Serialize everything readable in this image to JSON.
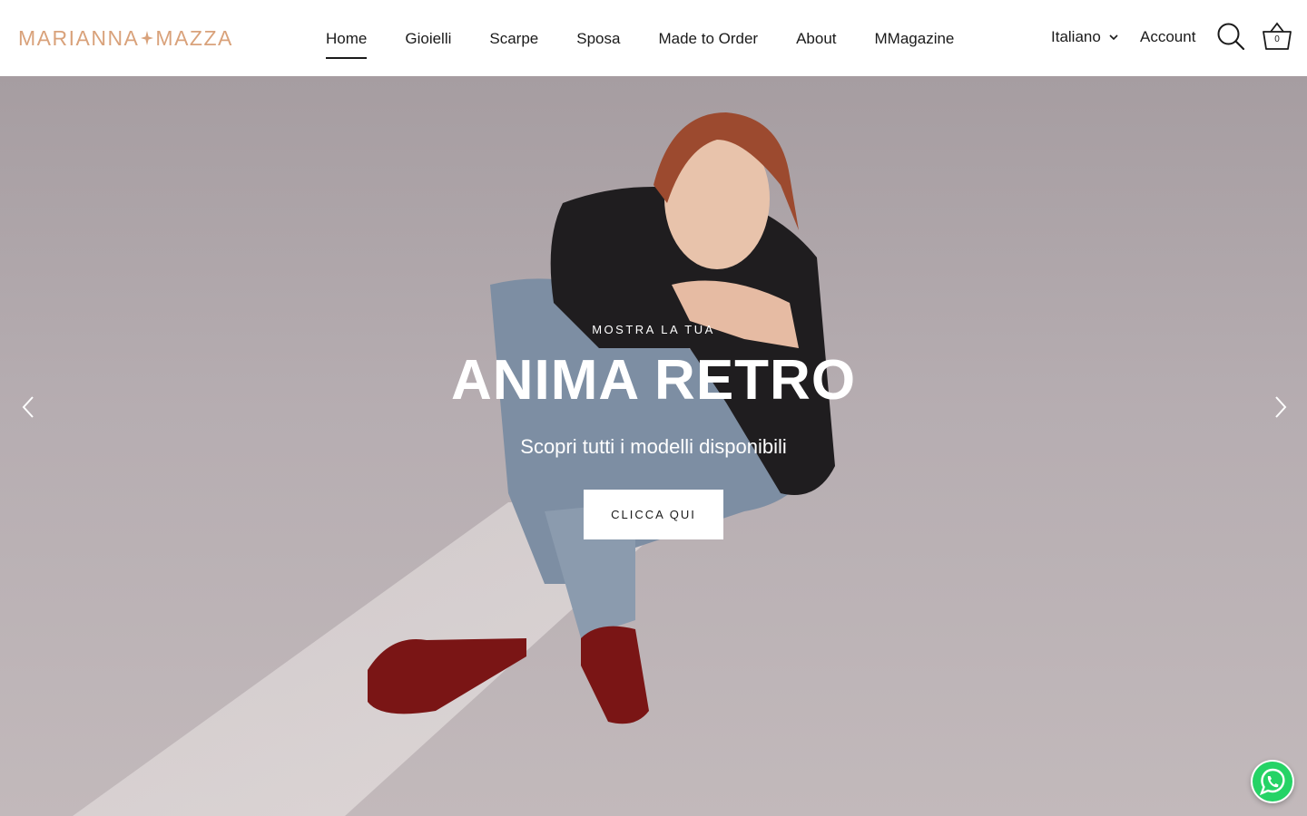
{
  "brand": {
    "part1": "MARIANNA",
    "part2": "MAZZA",
    "color": "#d9a27b"
  },
  "nav": {
    "items": [
      {
        "label": "Home",
        "active": true
      },
      {
        "label": "Gioielli"
      },
      {
        "label": "Scarpe"
      },
      {
        "label": "Sposa"
      },
      {
        "label": "Made to Order"
      },
      {
        "label": "About"
      },
      {
        "label": "MMagazine"
      }
    ]
  },
  "header": {
    "language": "Italiano",
    "account_label": "Account",
    "cart_count": "0",
    "icons": {
      "search": "search-icon",
      "cart": "basket-icon",
      "language": "chevron-down-icon"
    }
  },
  "hero": {
    "eyebrow": "MOSTRA LA TUA",
    "headline": "ANIMA RETRO",
    "subline": "Scopri tutti i modelli disponibili",
    "cta_label": "CLICCA QUI",
    "icons": {
      "prev": "chevron-left-icon",
      "next": "chevron-right-icon"
    }
  },
  "floating": {
    "icon": "whatsapp-icon",
    "color": "#25d366"
  }
}
